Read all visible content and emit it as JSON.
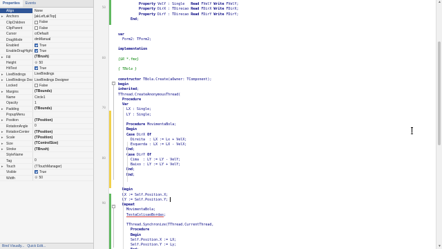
{
  "inspector": {
    "tabs": [
      {
        "label": "Properties",
        "active": true
      },
      {
        "label": "Events",
        "active": false
      }
    ],
    "properties": [
      {
        "name": "Align",
        "value": "None",
        "selected": true
      },
      {
        "name": "Anchors",
        "value": "[akLeft,akTop]",
        "expander": true
      },
      {
        "name": "ClipChildren",
        "value": "False",
        "checkbox": false
      },
      {
        "name": "ClipParent",
        "value": "False",
        "checkbox": false
      },
      {
        "name": "Cursor",
        "value": "crDefault"
      },
      {
        "name": "DragMode",
        "value": "dmManual"
      },
      {
        "name": "Enabled",
        "value": "True",
        "checkbox": true
      },
      {
        "name": "EnableDragHighlight",
        "value": "True",
        "checkbox": true
      },
      {
        "name": "Fill",
        "value": "(TBrush)",
        "bold": true,
        "expander": true
      },
      {
        "name": "Height",
        "value": "50",
        "gear": true
      },
      {
        "name": "HitTest",
        "value": "True",
        "checkbox": true
      },
      {
        "name": "LiveBindings",
        "value": "LiveBindings",
        "expander": true
      },
      {
        "name": "LiveBindings Designer",
        "value": "LiveBindings Designer",
        "expander": true
      },
      {
        "name": "Locked",
        "value": "False",
        "checkbox": false
      },
      {
        "name": "Margins",
        "value": "(TBounds)",
        "bold": true,
        "expander": true
      },
      {
        "name": "Name",
        "value": "Circle1"
      },
      {
        "name": "Opacity",
        "value": "1"
      },
      {
        "name": "Padding",
        "value": "(TBounds)",
        "bold": true,
        "expander": true
      },
      {
        "name": "PopupMenu",
        "value": ""
      },
      {
        "name": "Position",
        "value": "(TPosition)",
        "bold": true,
        "expander": true
      },
      {
        "name": "RotationAngle",
        "value": "0"
      },
      {
        "name": "RotationCenter",
        "value": "(TPosition)",
        "bold": true,
        "expander": true
      },
      {
        "name": "Scale",
        "value": "(TPosition)",
        "bold": true,
        "expander": true
      },
      {
        "name": "Size",
        "value": "(TControlSize)",
        "bold": true,
        "expander": true
      },
      {
        "name": "Stroke",
        "value": "(TBrush)",
        "bold": true,
        "expander": true
      },
      {
        "name": "StyleName",
        "value": ""
      },
      {
        "name": "Tag",
        "value": "0"
      },
      {
        "name": "Touch",
        "value": "(TTouchManager)",
        "expander": true
      },
      {
        "name": "Visible",
        "value": "True",
        "checkbox": true
      },
      {
        "name": "Width",
        "value": "50",
        "gear": true
      }
    ],
    "footer_links": [
      "Bind Visually...",
      "Quick Edit..."
    ]
  },
  "editor": {
    "lines": [
      {
        "num": "",
        "indent": 10,
        "tokens": [
          [
            "k",
            "Property"
          ],
          [
            "n",
            " VelY : Single   "
          ],
          [
            "k",
            "Read"
          ],
          [
            "n",
            " FVelY "
          ],
          [
            "k",
            "Write"
          ],
          [
            "n",
            " FVelY;"
          ]
        ]
      },
      {
        "num": "50",
        "indent": 10,
        "tokens": [
          [
            "k",
            "Property"
          ],
          [
            "n",
            " DirX : TDirecao "
          ],
          [
            "k",
            "Read"
          ],
          [
            "n",
            " FDirX "
          ],
          [
            "k",
            "Write"
          ],
          [
            "n",
            " FDirX;"
          ]
        ]
      },
      {
        "num": "",
        "indent": 10,
        "tokens": [
          [
            "k",
            "Property"
          ],
          [
            "n",
            " DirY : TDirecao "
          ],
          [
            "k",
            "Read"
          ],
          [
            "n",
            " FDirY "
          ],
          [
            "k",
            "Write"
          ],
          [
            "n",
            " FDirY;"
          ]
        ]
      },
      {
        "num": "",
        "indent": 6,
        "tokens": [
          [
            "k",
            "End"
          ],
          [
            "n",
            ";"
          ]
        ]
      },
      {
        "num": "",
        "indent": 0,
        "tokens": []
      },
      {
        "num": "",
        "indent": 0,
        "tokens": []
      },
      {
        "num": "",
        "indent": 0,
        "tokens": [
          [
            "k",
            "var"
          ]
        ]
      },
      {
        "num": "",
        "indent": 2,
        "tokens": [
          [
            "n",
            "Form2: TForm2;"
          ]
        ]
      },
      {
        "num": "",
        "indent": 0,
        "tokens": []
      },
      {
        "num": "",
        "indent": 0,
        "tokens": [
          [
            "k",
            "implementation"
          ]
        ]
      },
      {
        "num": "",
        "indent": 0,
        "tokens": []
      },
      {
        "num": "60",
        "indent": 0,
        "tokens": [
          [
            "c",
            "{$R *.fmx}"
          ]
        ]
      },
      {
        "num": "",
        "indent": 0,
        "tokens": []
      },
      {
        "num": "",
        "indent": 0,
        "tokens": [
          [
            "c",
            "{ TBola }"
          ]
        ]
      },
      {
        "num": "",
        "indent": 0,
        "tokens": []
      },
      {
        "num": "",
        "indent": 0,
        "tokens": [
          [
            "k",
            "constructor"
          ],
          [
            "n",
            " TBola.Create(aOwner: TComponent);"
          ]
        ]
      },
      {
        "num": "",
        "indent": 0,
        "tokens": [
          [
            "k",
            "begin"
          ]
        ]
      },
      {
        "num": "",
        "indent": 0,
        "tokens": [
          [
            "k",
            "inherited"
          ],
          [
            "n",
            ";"
          ]
        ]
      },
      {
        "num": "",
        "indent": 0,
        "tokens": [
          [
            "n",
            "TThread.CreateAnonymousThread("
          ]
        ]
      },
      {
        "num": "",
        "indent": 2,
        "tokens": [
          [
            "k",
            "Procedure"
          ]
        ]
      },
      {
        "num": "",
        "indent": 2,
        "tokens": [
          [
            "k",
            "Var"
          ]
        ]
      },
      {
        "num": "70",
        "indent": 4,
        "tokens": [
          [
            "n",
            "LX : Single;"
          ]
        ]
      },
      {
        "num": "",
        "indent": 4,
        "tokens": [
          [
            "n",
            "LY : Single;"
          ]
        ]
      },
      {
        "num": "",
        "indent": 0,
        "tokens": []
      },
      {
        "num": "",
        "indent": 4,
        "tokens": [
          [
            "k",
            "Procedure"
          ],
          [
            "n",
            " MovimentaBola;"
          ]
        ]
      },
      {
        "num": "",
        "indent": 4,
        "tokens": [
          [
            "k",
            "Begin"
          ]
        ]
      },
      {
        "num": "",
        "indent": 4,
        "tokens": [
          [
            "k",
            "Case"
          ],
          [
            "n",
            " DirX "
          ],
          [
            "k",
            "Of"
          ]
        ]
      },
      {
        "num": "",
        "indent": 6,
        "tokens": [
          [
            "n",
            "Direita  : LX := Lx + VelX;"
          ]
        ]
      },
      {
        "num": "",
        "indent": 6,
        "tokens": [
          [
            "n",
            "Esquerda : LX := LX - VelX;"
          ]
        ]
      },
      {
        "num": "",
        "indent": 4,
        "tokens": [
          [
            "k",
            "End"
          ],
          [
            "n",
            ";"
          ]
        ]
      },
      {
        "num": "",
        "indent": 4,
        "tokens": [
          [
            "k",
            "Case"
          ],
          [
            "n",
            " DirY "
          ],
          [
            "k",
            "Of"
          ]
        ]
      },
      {
        "num": "80",
        "indent": 6,
        "tokens": [
          [
            "n",
            "Cima  : LY := LY - VelY;"
          ]
        ]
      },
      {
        "num": "",
        "indent": 6,
        "tokens": [
          [
            "n",
            "Baixo : LY := LY + VelY;"
          ]
        ]
      },
      {
        "num": "",
        "indent": 4,
        "tokens": [
          [
            "k",
            "End"
          ],
          [
            "n",
            ";"
          ]
        ]
      },
      {
        "num": "",
        "indent": 4,
        "tokens": [
          [
            "k",
            "End"
          ],
          [
            "n",
            ";"
          ]
        ]
      },
      {
        "num": "",
        "indent": 0,
        "tokens": []
      },
      {
        "num": "",
        "indent": 0,
        "tokens": []
      },
      {
        "num": "",
        "indent": 2,
        "tokens": [
          [
            "k",
            "Begin"
          ]
        ]
      },
      {
        "num": "",
        "indent": 2,
        "tokens": [
          [
            "n",
            "LX := Self.Position.X;"
          ]
        ]
      },
      {
        "num": "",
        "indent": 2,
        "tokens": [
          [
            "n",
            "LY := Self.Position.Y;"
          ]
        ]
      },
      {
        "num": "90",
        "indent": 2,
        "tokens": [
          [
            "k",
            "Repeat"
          ]
        ]
      },
      {
        "num": "",
        "indent": 4,
        "tokens": [
          [
            "n",
            "MovimentaBola;"
          ]
        ]
      },
      {
        "num": "",
        "indent": 4,
        "tokens": [
          [
            "u",
            "TestaColisaoBordas"
          ],
          [
            "n",
            ";"
          ]
        ]
      },
      {
        "num": "",
        "indent": 0,
        "tokens": []
      },
      {
        "num": "",
        "indent": 4,
        "tokens": [
          [
            "n",
            "TThread.Synchronize(TThread.CurrentThread,"
          ]
        ]
      },
      {
        "num": "",
        "indent": 6,
        "tokens": [
          [
            "k",
            "Procedure"
          ]
        ]
      },
      {
        "num": "",
        "indent": 6,
        "tokens": [
          [
            "k",
            "Begin"
          ]
        ]
      },
      {
        "num": "",
        "indent": 6,
        "tokens": [
          [
            "n",
            "Self.Position.X := LX;"
          ]
        ]
      },
      {
        "num": "",
        "indent": 6,
        "tokens": [
          [
            "n",
            "Self.Position.Y := Ly;"
          ]
        ]
      },
      {
        "num": "",
        "indent": 6,
        "tokens": [
          [
            "k",
            "End"
          ],
          [
            "n",
            ";"
          ]
        ]
      }
    ]
  }
}
